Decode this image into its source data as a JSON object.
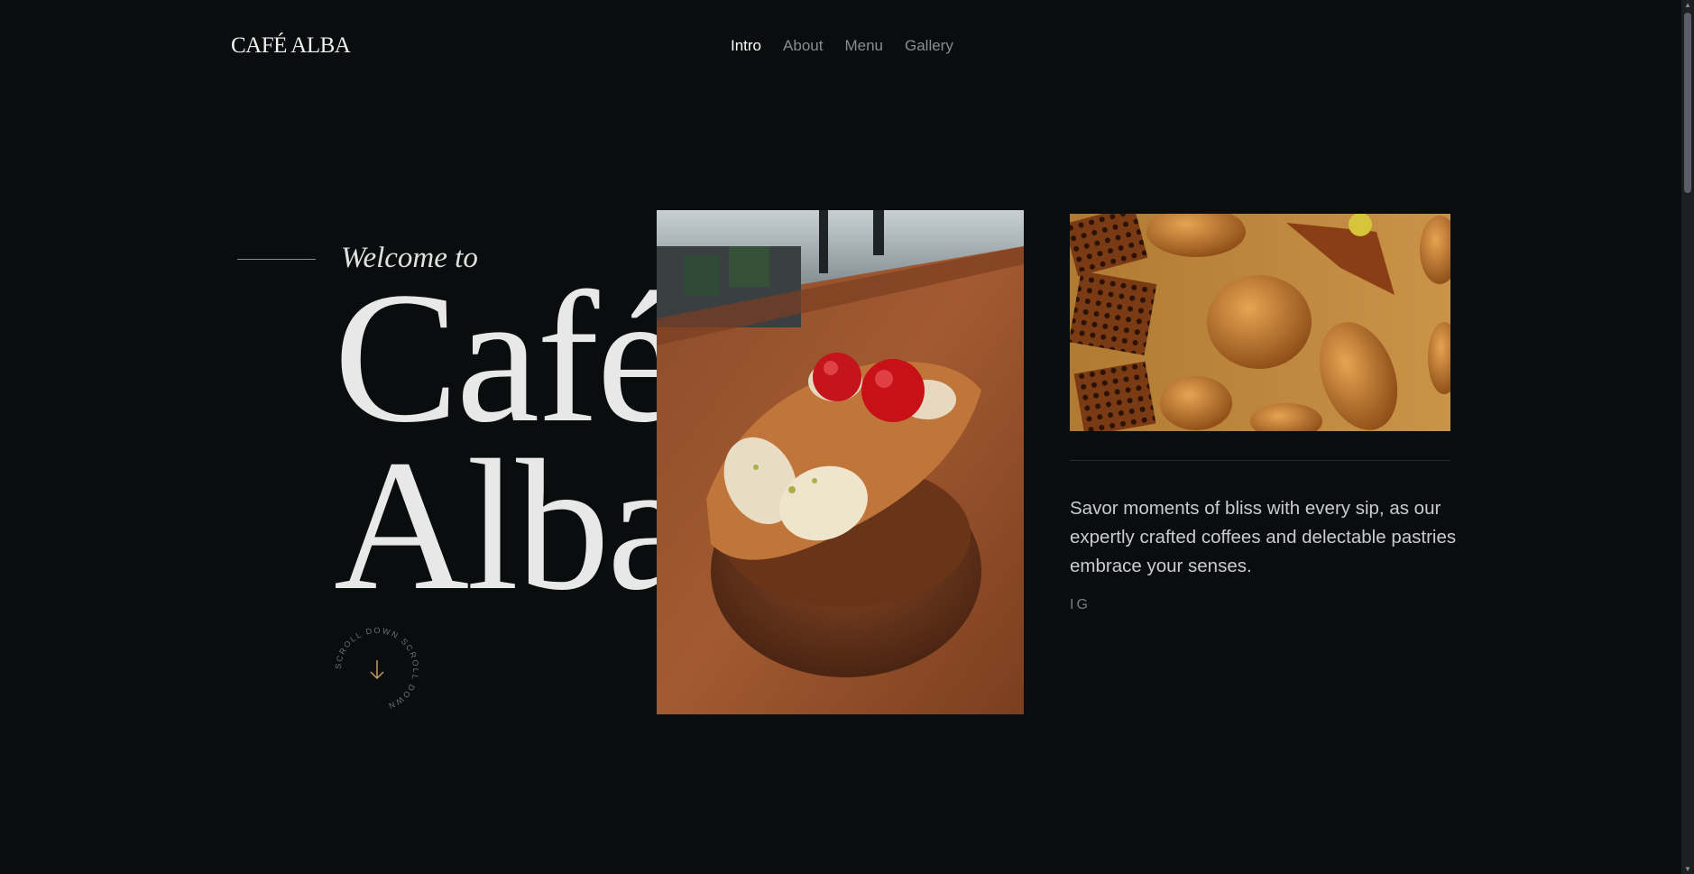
{
  "brand": {
    "logo": "CAFÉ ALBA"
  },
  "nav": {
    "items": [
      {
        "label": "Intro",
        "active": true
      },
      {
        "label": "About",
        "active": false
      },
      {
        "label": "Menu",
        "active": false
      },
      {
        "label": "Gallery",
        "active": false
      }
    ]
  },
  "hero": {
    "welcome": "Welcome to",
    "title_line1": "Café",
    "title_line2": "Alba",
    "scroll_text": "SCROLL DOWN SCROLL DOWN"
  },
  "aside": {
    "description": "Savor moments of bliss with every sip, as our expertly crafted coffees and delectable pastries embrace your senses.",
    "social": "IG"
  },
  "colors": {
    "background": "#0a0d0e",
    "accent": "#c89a5a",
    "text": "#e6e6e6"
  }
}
